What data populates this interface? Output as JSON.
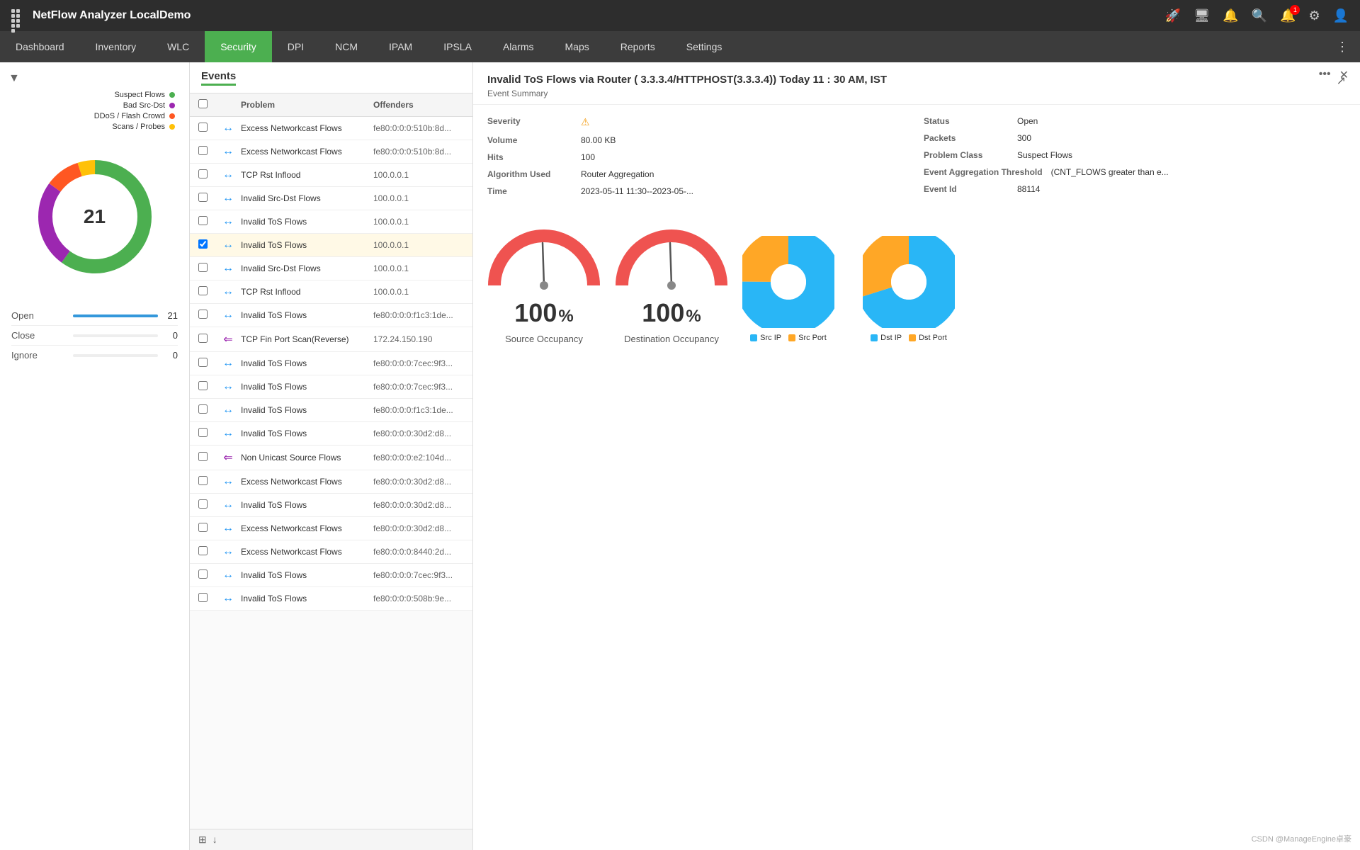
{
  "app": {
    "title": "NetFlow Analyzer LocalDemo"
  },
  "topbar": {
    "icons": [
      "rocket-icon",
      "monitor-icon",
      "bell-icon",
      "search-icon",
      "notification-icon",
      "settings-icon",
      "user-icon"
    ],
    "notification_count": "1"
  },
  "nav": {
    "items": [
      {
        "label": "Dashboard",
        "active": false
      },
      {
        "label": "Inventory",
        "active": false
      },
      {
        "label": "WLC",
        "active": false
      },
      {
        "label": "Security",
        "active": true
      },
      {
        "label": "DPI",
        "active": false
      },
      {
        "label": "NCM",
        "active": false
      },
      {
        "label": "IPAM",
        "active": false
      },
      {
        "label": "IPSLA",
        "active": false
      },
      {
        "label": "Alarms",
        "active": false
      },
      {
        "label": "Maps",
        "active": false
      },
      {
        "label": "Reports",
        "active": false
      },
      {
        "label": "Settings",
        "active": false
      }
    ]
  },
  "sidebar": {
    "donut": {
      "center_value": "21",
      "labels": [
        {
          "name": "Suspect Flows",
          "color": "#4caf50"
        },
        {
          "name": "Bad Src-Dst",
          "color": "#9c27b0"
        },
        {
          "name": "DDoS / Flash Crowd",
          "color": "#ff5722"
        },
        {
          "name": "Scans / Probes",
          "color": "#ffc107"
        }
      ]
    },
    "status": [
      {
        "label": "Open",
        "count": "21",
        "bar_pct": 100
      },
      {
        "label": "Close",
        "count": "0",
        "bar_pct": 0
      },
      {
        "label": "Ignore",
        "count": "0",
        "bar_pct": 0
      }
    ]
  },
  "events": {
    "title": "Events",
    "columns": {
      "problem": "Problem",
      "offenders": "Offenders"
    },
    "rows": [
      {
        "id": 1,
        "icon": "blue",
        "problem": "Excess Networkcast Flows",
        "offender": "fe80:0:0:0:510b:8d...",
        "selected": false
      },
      {
        "id": 2,
        "icon": "blue",
        "problem": "Excess Networkcast Flows",
        "offender": "fe80:0:0:0:510b:8d...",
        "selected": false
      },
      {
        "id": 3,
        "icon": "blue",
        "problem": "TCP Rst Inflood",
        "offender": "100.0.0.1",
        "selected": false
      },
      {
        "id": 4,
        "icon": "blue",
        "problem": "Invalid Src-Dst Flows",
        "offender": "100.0.0.1",
        "selected": false
      },
      {
        "id": 5,
        "icon": "blue",
        "problem": "Invalid ToS Flows",
        "offender": "100.0.0.1",
        "selected": false
      },
      {
        "id": 6,
        "icon": "blue",
        "problem": "Invalid ToS Flows",
        "offender": "100.0.0.1",
        "selected": true
      },
      {
        "id": 7,
        "icon": "blue",
        "problem": "Invalid Src-Dst Flows",
        "offender": "100.0.0.1",
        "selected": false
      },
      {
        "id": 8,
        "icon": "blue",
        "problem": "TCP Rst Inflood",
        "offender": "100.0.0.1",
        "selected": false
      },
      {
        "id": 9,
        "icon": "blue",
        "problem": "Invalid ToS Flows",
        "offender": "fe80:0:0:0:f1c3:1de...",
        "selected": false
      },
      {
        "id": 10,
        "icon": "purple",
        "problem": "TCP Fin Port Scan(Reverse)",
        "offender": "172.24.150.190",
        "selected": false
      },
      {
        "id": 11,
        "icon": "blue",
        "problem": "Invalid ToS Flows",
        "offender": "fe80:0:0:0:7cec:9f3...",
        "selected": false
      },
      {
        "id": 12,
        "icon": "blue",
        "problem": "Invalid ToS Flows",
        "offender": "fe80:0:0:0:7cec:9f3...",
        "selected": false
      },
      {
        "id": 13,
        "icon": "blue",
        "problem": "Invalid ToS Flows",
        "offender": "fe80:0:0:0:f1c3:1de...",
        "selected": false
      },
      {
        "id": 14,
        "icon": "blue",
        "problem": "Invalid ToS Flows",
        "offender": "fe80:0:0:0:30d2:d8...",
        "selected": false
      },
      {
        "id": 15,
        "icon": "purple",
        "problem": "Non Unicast Source Flows",
        "offender": "fe80:0:0:0:e2:104d...",
        "selected": false
      },
      {
        "id": 16,
        "icon": "blue",
        "problem": "Excess Networkcast Flows",
        "offender": "fe80:0:0:0:30d2:d8...",
        "selected": false
      },
      {
        "id": 17,
        "icon": "blue",
        "problem": "Invalid ToS Flows",
        "offender": "fe80:0:0:0:30d2:d8...",
        "selected": false
      },
      {
        "id": 18,
        "icon": "blue",
        "problem": "Excess Networkcast Flows",
        "offender": "fe80:0:0:0:30d2:d8...",
        "selected": false
      },
      {
        "id": 19,
        "icon": "blue",
        "problem": "Excess Networkcast Flows",
        "offender": "fe80:0:0:0:8440:2d...",
        "selected": false
      },
      {
        "id": 20,
        "icon": "blue",
        "problem": "Invalid ToS Flows",
        "offender": "fe80:0:0:0:7cec:9f3...",
        "selected": false
      },
      {
        "id": 21,
        "icon": "blue",
        "problem": "Invalid ToS Flows",
        "offender": "fe80:0:0:0:508b:9e...",
        "selected": false
      }
    ]
  },
  "detail": {
    "title": "Invalid ToS Flows via Router ( 3.3.3.4/HTTPHOST(3.3.3.4)) Today 11 : 30 AM, IST",
    "subtitle": "Event Summary",
    "fields": {
      "severity_label": "Severity",
      "severity_icon": "warning",
      "status_label": "Status",
      "status_value": "Open",
      "volume_label": "Volume",
      "volume_value": "80.00 KB",
      "packets_label": "Packets",
      "packets_value": "300",
      "hits_label": "Hits",
      "hits_value": "100",
      "problem_class_label": "Problem Class",
      "problem_class_value": "Suspect Flows",
      "algorithm_label": "Algorithm Used",
      "algorithm_value": "Router Aggregation",
      "event_agg_label": "Event Aggregation Threshold",
      "event_agg_value": "(CNT_FLOWS greater than e...",
      "time_label": "Time",
      "time_value": "2023-05-11 11:30--2023-05-...",
      "event_id_label": "Event Id",
      "event_id_value": "88114"
    },
    "gauges": {
      "source": {
        "value": "100",
        "label": "Source Occupancy"
      },
      "destination": {
        "value": "100",
        "label": "Destination Occupancy"
      }
    },
    "pies": {
      "left": {
        "legend": [
          {
            "label": "Src IP",
            "color": "#29b6f6"
          },
          {
            "label": "Src Port",
            "color": "#ffa726"
          }
        ]
      },
      "right": {
        "legend": [
          {
            "label": "Dst IP",
            "color": "#29b6f6"
          },
          {
            "label": "Dst Port",
            "color": "#ffa726"
          }
        ]
      }
    }
  },
  "watermark": "CSDN @ManageEngine卓豪"
}
